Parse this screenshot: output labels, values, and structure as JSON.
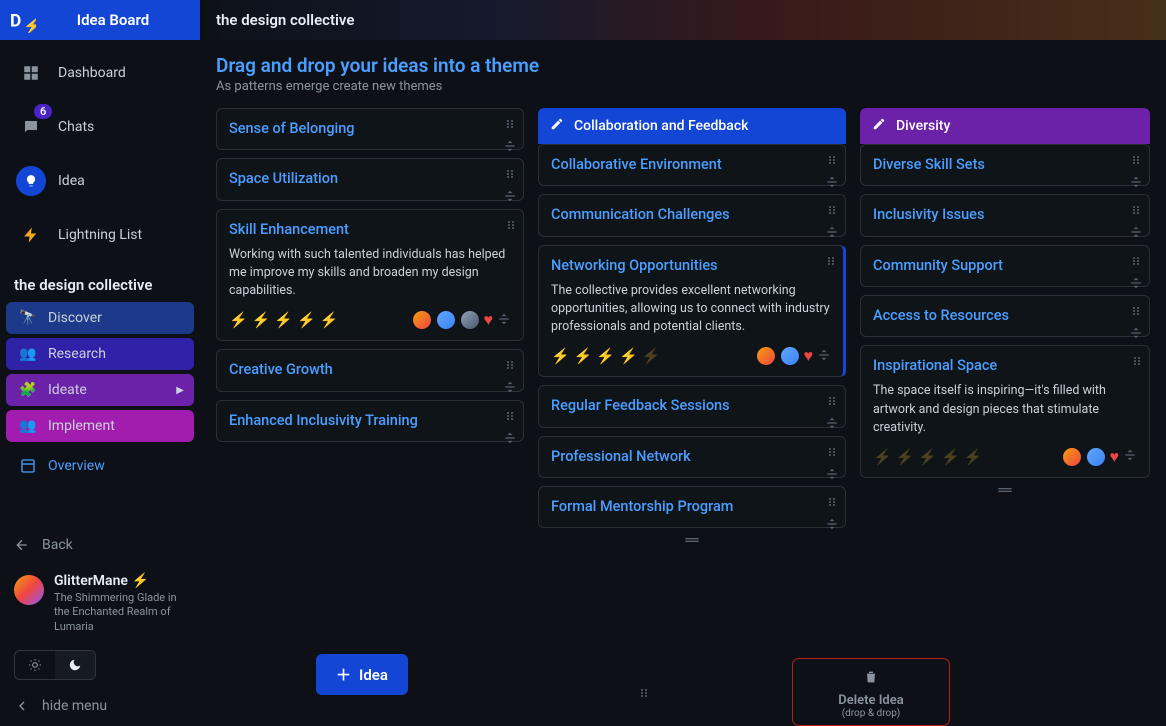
{
  "sidebar": {
    "title": "Idea Board",
    "nav": [
      {
        "label": "Dashboard",
        "icon": "dashboard"
      },
      {
        "label": "Chats",
        "icon": "chat",
        "badge": "6"
      },
      {
        "label": "Idea",
        "icon": "bulb",
        "active": true
      },
      {
        "label": "Lightning List",
        "icon": "bolt"
      }
    ],
    "project_name": "the design collective",
    "stages": [
      {
        "label": "Discover",
        "icon": "binoculars"
      },
      {
        "label": "Research",
        "icon": "search"
      },
      {
        "label": "Ideate",
        "icon": "brain",
        "chevron": true
      },
      {
        "label": "Implement",
        "icon": "users"
      }
    ],
    "overview_label": "Overview",
    "back_label": "Back",
    "user": {
      "name": "GlitterMane",
      "sub": "The Shimmering Glade in the Enchanted Realm of Lumaria"
    },
    "hide_menu_label": "hide menu"
  },
  "topbar": {
    "title": "the design collective"
  },
  "header": {
    "title": "Drag and drop your ideas into a theme",
    "subtitle": "As patterns emerge create new themes"
  },
  "columns": [
    {
      "cards": [
        {
          "title": "Sense of Belonging"
        },
        {
          "title": "Space Utilization"
        },
        {
          "title": "Skill Enhancement",
          "body": "Working with such talented individuals has helped me improve my skills and broaden my design capabilities.",
          "bolts": 5,
          "avatars": 3,
          "heart": true,
          "expanded": true
        },
        {
          "title": "Creative Growth"
        },
        {
          "title": "Enhanced Inclusivity Training"
        }
      ],
      "add_label": "Idea"
    },
    {
      "name": "Collaboration and Feedback",
      "cards": [
        {
          "title": "Collaborative Environment"
        },
        {
          "title": "Communication Challenges"
        },
        {
          "title": "Networking Opportunities",
          "body": "The collective provides excellent networking opportunities, allowing us to connect with industry professionals and potential clients.",
          "bolts": 4,
          "dim_bolts": 1,
          "avatars": 2,
          "heart": true,
          "expanded": true,
          "selected": true
        },
        {
          "title": "Regular Feedback Sessions"
        },
        {
          "title": "Professional Network"
        },
        {
          "title": "Formal Mentorship Program"
        }
      ]
    },
    {
      "name": "Diversity",
      "cards": [
        {
          "title": "Diverse Skill Sets"
        },
        {
          "title": "Inclusivity Issues"
        },
        {
          "title": "Community Support"
        },
        {
          "title": "Access to Resources"
        },
        {
          "title": "Inspirational Space",
          "body": "The space itself is inspiring—it's filled with artwork and design pieces that stimulate creativity.",
          "bolts": 0,
          "dim_bolts": 5,
          "avatars": 2,
          "heart": true,
          "expanded": true
        }
      ]
    }
  ],
  "delete_zone": {
    "title": "Delete Idea",
    "sub": "(drop & drop)"
  }
}
